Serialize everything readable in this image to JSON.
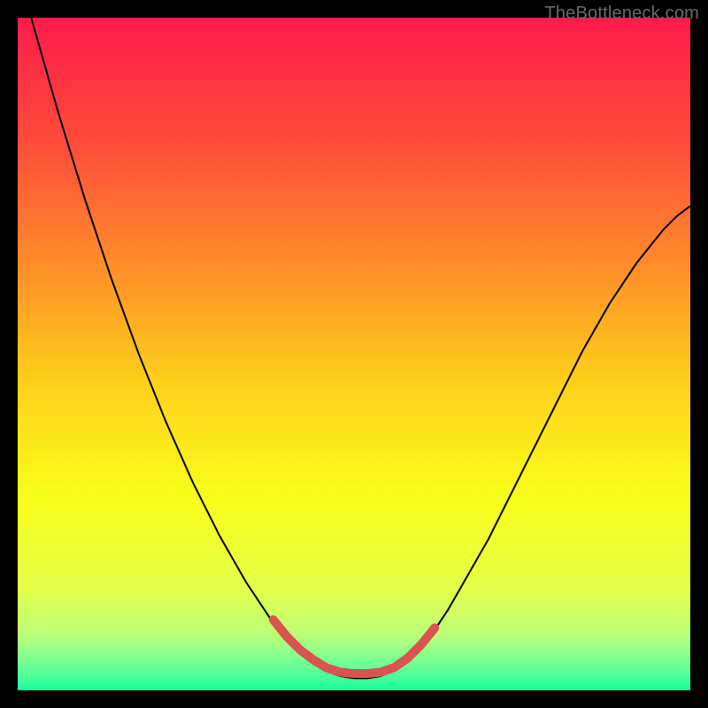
{
  "watermark": "TheBottleneck.com",
  "chart_data": {
    "type": "line",
    "title": "",
    "xlabel": "",
    "ylabel": "",
    "xlim": [
      0,
      100
    ],
    "ylim": [
      0,
      100
    ],
    "grid": false,
    "legend": false,
    "background_gradient": {
      "stops": [
        {
          "pos": 0.0,
          "color": "#ff1b4b"
        },
        {
          "pos": 0.18,
          "color": "#ff4a3b"
        },
        {
          "pos": 0.36,
          "color": "#ff8a2a"
        },
        {
          "pos": 0.55,
          "color": "#ffd21a"
        },
        {
          "pos": 0.72,
          "color": "#f8ff1a"
        },
        {
          "pos": 0.85,
          "color": "#e4ff4a"
        },
        {
          "pos": 0.92,
          "color": "#b8ff7a"
        },
        {
          "pos": 0.97,
          "color": "#5fff9a"
        },
        {
          "pos": 1.0,
          "color": "#18ff9a"
        }
      ]
    },
    "series": [
      {
        "name": "dip-curve",
        "stroke": "#000000",
        "stroke_width": 2,
        "points": [
          [
            2,
            100
          ],
          [
            4,
            93
          ],
          [
            6,
            86
          ],
          [
            8,
            79.5
          ],
          [
            10,
            73
          ],
          [
            12,
            67
          ],
          [
            14,
            61
          ],
          [
            16,
            55.5
          ],
          [
            18,
            50
          ],
          [
            20,
            45
          ],
          [
            22,
            40
          ],
          [
            24,
            35.5
          ],
          [
            26,
            31
          ],
          [
            28,
            27
          ],
          [
            30,
            23
          ],
          [
            32,
            19.5
          ],
          [
            34,
            16
          ],
          [
            36,
            13
          ],
          [
            38,
            10
          ],
          [
            40,
            7.5
          ],
          [
            42,
            5.5
          ],
          [
            44,
            4
          ],
          [
            46,
            2.8
          ],
          [
            48,
            2.1
          ],
          [
            50,
            1.8
          ],
          [
            52,
            1.8
          ],
          [
            54,
            2.1
          ],
          [
            56,
            3
          ],
          [
            58,
            4.5
          ],
          [
            60,
            6.5
          ],
          [
            62,
            9
          ],
          [
            64,
            12
          ],
          [
            66,
            15.5
          ],
          [
            68,
            19
          ],
          [
            70,
            22.5
          ],
          [
            72,
            26.5
          ],
          [
            74,
            30.5
          ],
          [
            76,
            34.5
          ],
          [
            78,
            38.5
          ],
          [
            80,
            42.5
          ],
          [
            82,
            46.5
          ],
          [
            84,
            50.5
          ],
          [
            86,
            54
          ],
          [
            88,
            57.5
          ],
          [
            90,
            60.5
          ],
          [
            92,
            63.5
          ],
          [
            94,
            66
          ],
          [
            96,
            68.5
          ],
          [
            98,
            70.5
          ],
          [
            100,
            72
          ]
        ]
      },
      {
        "name": "bottom-highlight",
        "stroke": "#d9534f",
        "stroke_width": 10,
        "linecap": "round",
        "points": [
          [
            38,
            10.5
          ],
          [
            40,
            8
          ],
          [
            42,
            6
          ],
          [
            44,
            4.5
          ],
          [
            46,
            3.3
          ],
          [
            48,
            2.7
          ],
          [
            50,
            2.5
          ],
          [
            52,
            2.5
          ],
          [
            54,
            2.7
          ],
          [
            56,
            3.4
          ],
          [
            58,
            4.8
          ],
          [
            60,
            6.8
          ],
          [
            62,
            9.3
          ]
        ]
      }
    ]
  }
}
